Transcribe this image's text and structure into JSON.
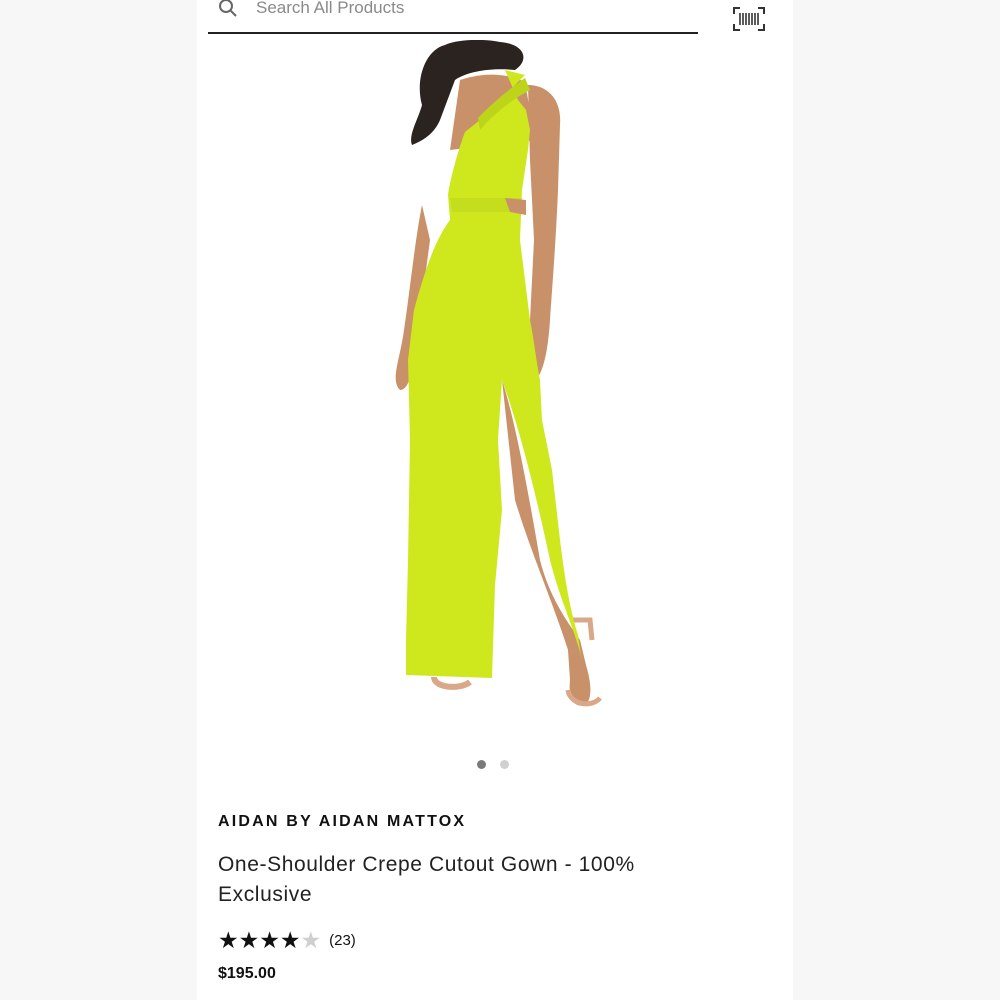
{
  "search": {
    "placeholder": "Search All Products"
  },
  "icons": {
    "search": "search-icon",
    "scan": "barcode-scan-icon"
  },
  "gallery": {
    "image_count": 2,
    "active_index": 0,
    "image_alt": "Woman wearing lime green one-shoulder gown"
  },
  "product": {
    "brand": "AIDAN BY AIDAN MATTOX",
    "name": "One-Shoulder Crepe Cutout Gown - 100% Exclusive",
    "rating": 4,
    "rating_max": 5,
    "review_count": "(23)",
    "price": "$195.00"
  },
  "colors": {
    "dress": "#cfe81e",
    "star_filled": "#111111",
    "star_empty": "#cfcfcf"
  }
}
